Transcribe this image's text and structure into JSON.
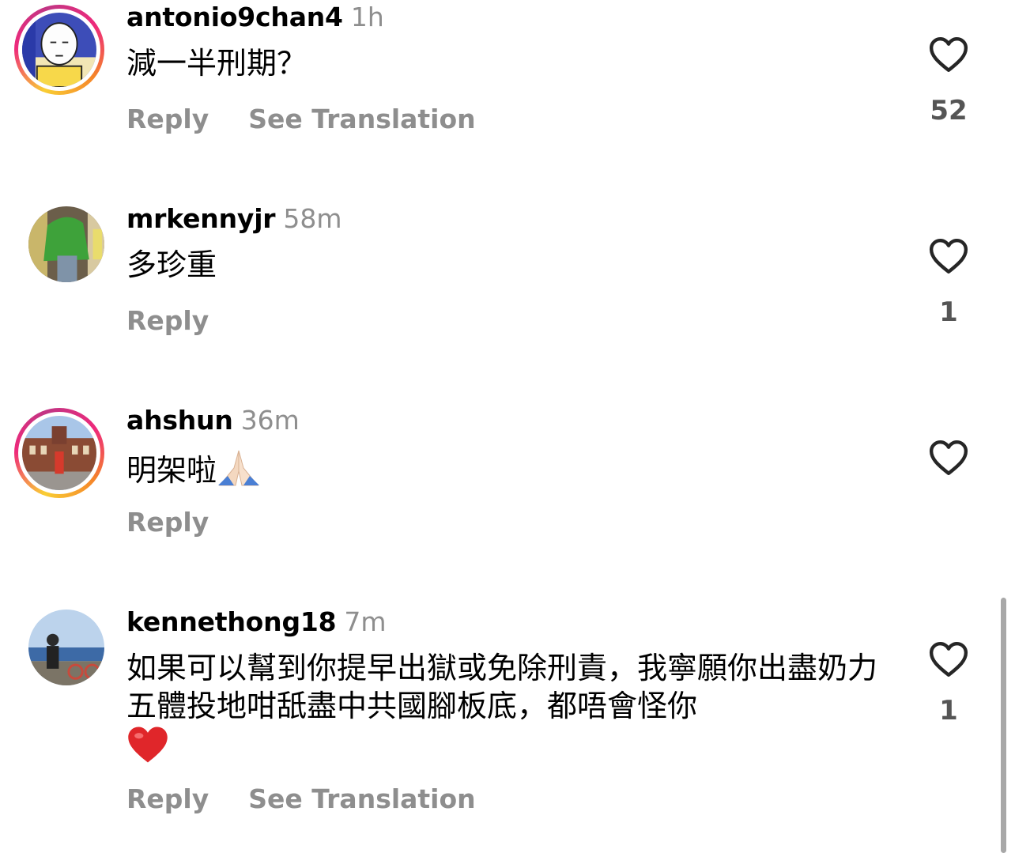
{
  "comments": [
    {
      "username": "antonio9chan4",
      "time": "1h",
      "text": "減一半刑期？",
      "reply_label": "Reply",
      "translate_label": "See Translation",
      "likes": "52",
      "story_ring": true,
      "avatar_icon": "anime-character-avatar"
    },
    {
      "username": "mrkennyjr",
      "time": "58m",
      "text": "多珍重",
      "reply_label": "Reply",
      "likes": "1",
      "story_ring": false,
      "avatar_icon": "green-jacket-avatar"
    },
    {
      "username": "ahshun",
      "time": "36m",
      "text": "明架啦",
      "emoji": "folded-hands",
      "reply_label": "Reply",
      "likes": "",
      "story_ring": true,
      "avatar_icon": "station-building-avatar"
    },
    {
      "username": "kennethong18",
      "time": "7m",
      "text": "如果可以幫到你提早出獄或免除刑責，我寧願你出盡奶力五體投地咁舐盡中共國腳板底，都唔會怪你",
      "emoji": "red-heart",
      "reply_label": "Reply",
      "translate_label": "See Translation",
      "likes": "1",
      "story_ring": false,
      "avatar_icon": "seaside-person-avatar"
    }
  ],
  "colors": {
    "secondary_text": "#8e8e8e",
    "heart_outline": "#262626",
    "like_count": "#555555",
    "heart_emoji": "#e0262a",
    "story_ring_start": "#f9ce34",
    "story_ring_mid": "#ee2a7b",
    "story_ring_end": "#c13584"
  }
}
